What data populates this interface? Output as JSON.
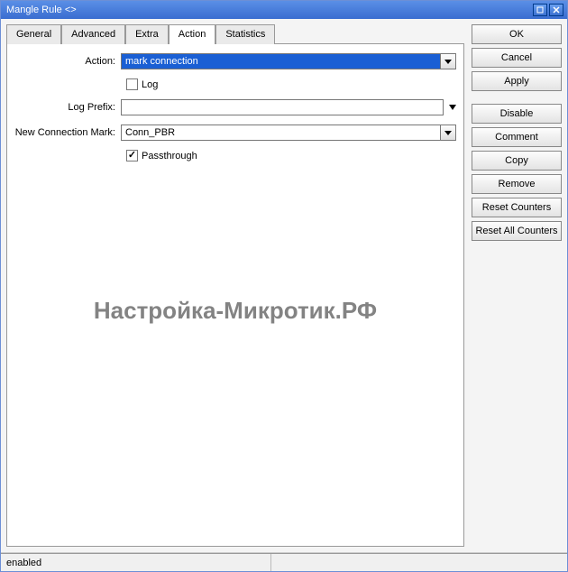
{
  "window": {
    "title": "Mangle Rule <>"
  },
  "tabs": {
    "general": "General",
    "advanced": "Advanced",
    "extra": "Extra",
    "action": "Action",
    "statistics": "Statistics"
  },
  "form": {
    "action_label": "Action:",
    "action_value": "mark connection",
    "log_checkbox": "Log",
    "log_prefix_label": "Log Prefix:",
    "log_prefix_value": "",
    "new_conn_mark_label": "New Connection Mark:",
    "new_conn_mark_value": "Conn_PBR",
    "passthrough_checkbox": "Passthrough"
  },
  "buttons": {
    "ok": "OK",
    "cancel": "Cancel",
    "apply": "Apply",
    "disable": "Disable",
    "comment": "Comment",
    "copy": "Copy",
    "remove": "Remove",
    "reset_counters": "Reset Counters",
    "reset_all_counters": "Reset All Counters"
  },
  "status": {
    "state": "enabled"
  },
  "watermark": "Настройка-Микротик.РФ"
}
